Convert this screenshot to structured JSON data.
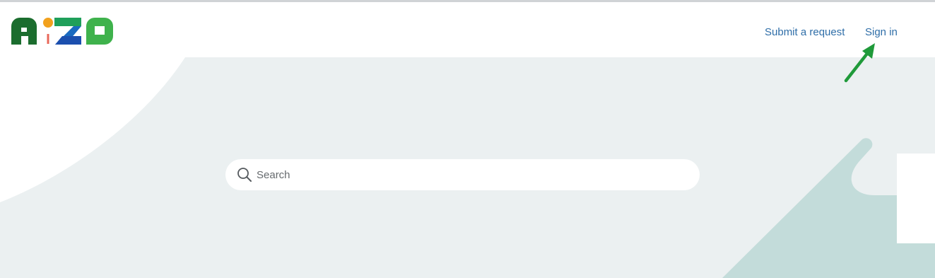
{
  "header": {
    "logo_name": "eizo-logo",
    "nav": {
      "submit_request": "Submit a request",
      "sign_in": "Sign in"
    }
  },
  "search": {
    "placeholder": "Search",
    "value": "",
    "icon": "search-icon"
  },
  "annotation": {
    "icon": "arrow-icon",
    "color": "#1f9a3a"
  },
  "colors": {
    "hero_bg": "#ebf0f1",
    "accent_shape": "#c3dcda",
    "link": "#2f6ea8"
  }
}
